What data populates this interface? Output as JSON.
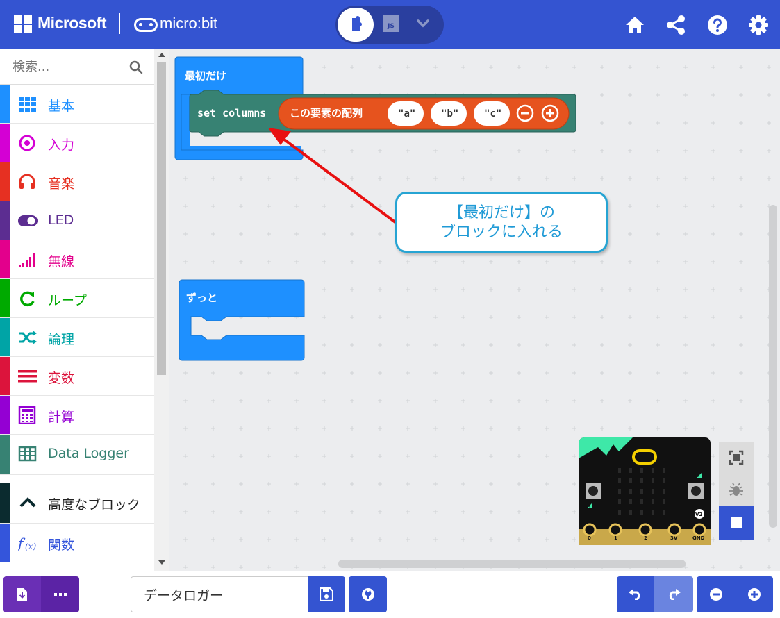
{
  "header": {
    "brand": "Microsoft",
    "product": "micro:bit",
    "editor_toggle": {
      "js_label": "JS"
    },
    "buttons": [
      "home-icon",
      "share-icon",
      "help-icon",
      "settings-icon"
    ]
  },
  "sidebar": {
    "search_placeholder": "検索...",
    "categories": [
      {
        "label": "基本",
        "color": "#1e90ff",
        "icon": "grid-icon"
      },
      {
        "label": "入力",
        "color": "#d400d4",
        "icon": "target-icon"
      },
      {
        "label": "音楽",
        "color": "#e63022",
        "icon": "headphones-icon"
      },
      {
        "label": "LED",
        "color": "#5c2d91",
        "icon": "toggle-icon"
      },
      {
        "label": "無線",
        "color": "#e3008c",
        "icon": "signal-bars-icon"
      },
      {
        "label": "ループ",
        "color": "#00aa00",
        "icon": "refresh-icon"
      },
      {
        "label": "論理",
        "color": "#00a4a6",
        "icon": "shuffle-icon"
      },
      {
        "label": "変数",
        "color": "#dc143c",
        "icon": "list-icon"
      },
      {
        "label": "計算",
        "color": "#9400d3",
        "icon": "calculator-icon"
      },
      {
        "label": "Data Logger",
        "color": "#378273",
        "icon": "table-icon"
      },
      {
        "label": "高度なブロック",
        "color": "#0b2b2f",
        "icon": "chevron-up-icon"
      },
      {
        "label": "関数",
        "color": "#3455db",
        "icon": "function-icon"
      }
    ]
  },
  "workspace": {
    "on_start_label": "最初だけ",
    "set_block": {
      "label": "set columns",
      "array_label": "この要素の配列",
      "items": [
        "a",
        "b",
        "c"
      ]
    },
    "forever_label": "ずっと",
    "callout": {
      "line1": "【最初だけ】の",
      "line2": "ブロックに入れる"
    }
  },
  "simulator": {
    "pins": [
      "0",
      "1",
      "2",
      "3V",
      "GND"
    ],
    "badge": "V2",
    "button_a": "A",
    "button_b": "B"
  },
  "footer": {
    "project_name": "データロガー"
  },
  "colors": {
    "header": "#3454d1",
    "block_blue": "#1e90ff",
    "block_teal": "#378273",
    "array_orange": "#e6531e",
    "callout_border": "#26a4d3"
  }
}
